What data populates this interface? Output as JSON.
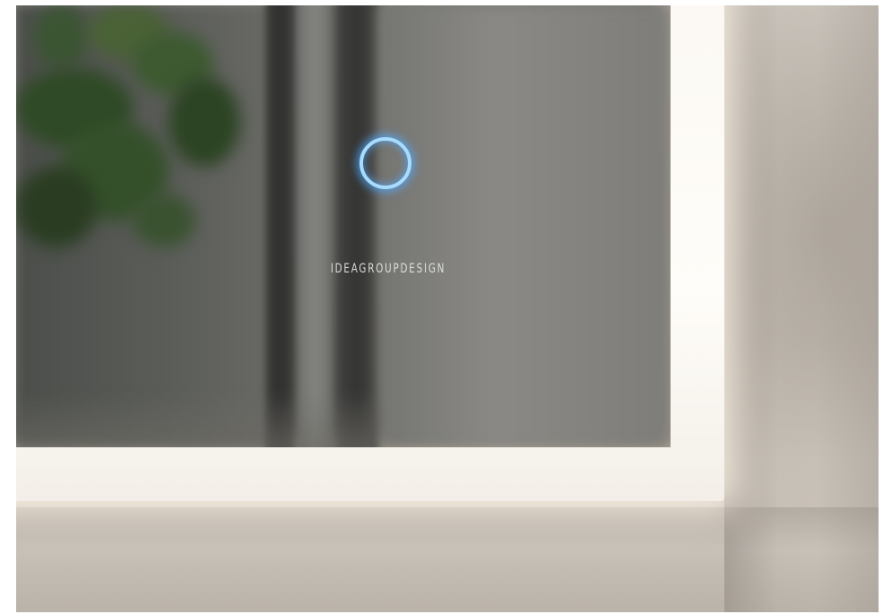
{
  "scene": {
    "description_label": "",
    "touch_button_icon": "touch-ring-icon",
    "touch_button_color": "#a8dcff",
    "frame_light_color": "#fffdf9",
    "brand_text": "IDEAGROUPDESIGN"
  }
}
